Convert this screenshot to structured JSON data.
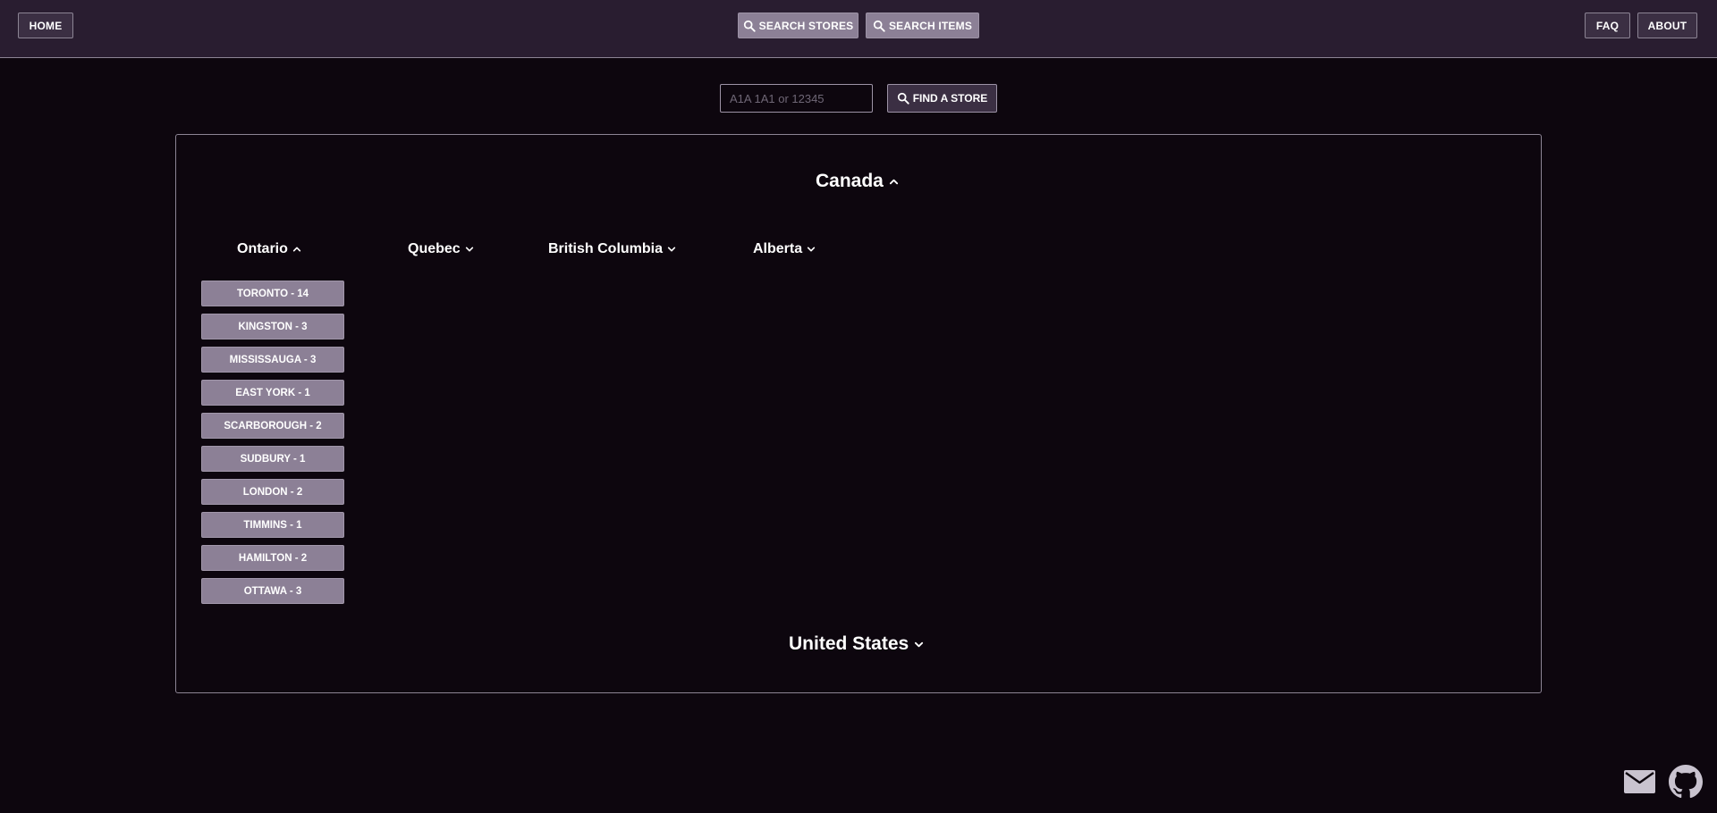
{
  "header": {
    "home_label": "HOME",
    "search_stores_label": "SEARCH STORES",
    "search_items_label": "SEARCH ITEMS",
    "faq_label": "FAQ",
    "about_label": "ABOUT"
  },
  "search": {
    "placeholder": "A1A 1A1 or 12345",
    "value": "",
    "button_label": "FIND A STORE"
  },
  "countries": [
    {
      "name": "Canada",
      "expanded": true,
      "provinces": [
        {
          "name": "Ontario",
          "expanded": true,
          "cities": [
            "TORONTO - 14",
            "KINGSTON - 3",
            "MISSISSAUGA - 3",
            "EAST YORK - 1",
            "SCARBOROUGH - 2",
            "SUDBURY - 1",
            "LONDON - 2",
            "TIMMINS - 1",
            "HAMILTON - 2",
            "OTTAWA - 3"
          ]
        },
        {
          "name": "Quebec",
          "expanded": false
        },
        {
          "name": "British Columbia",
          "expanded": false
        },
        {
          "name": "Alberta",
          "expanded": false
        }
      ]
    },
    {
      "name": "United States",
      "expanded": false
    }
  ],
  "icons": {
    "search": "search-icon",
    "chevron_up": "chevron-up-icon",
    "chevron_down": "chevron-down-icon",
    "mail": "mail-icon",
    "github": "github-icon"
  },
  "colors": {
    "background": "#0d060e",
    "header": "#291d30",
    "button_light": "#8c8096",
    "button_dark": "#3b2f43",
    "border": "#8c8494"
  }
}
